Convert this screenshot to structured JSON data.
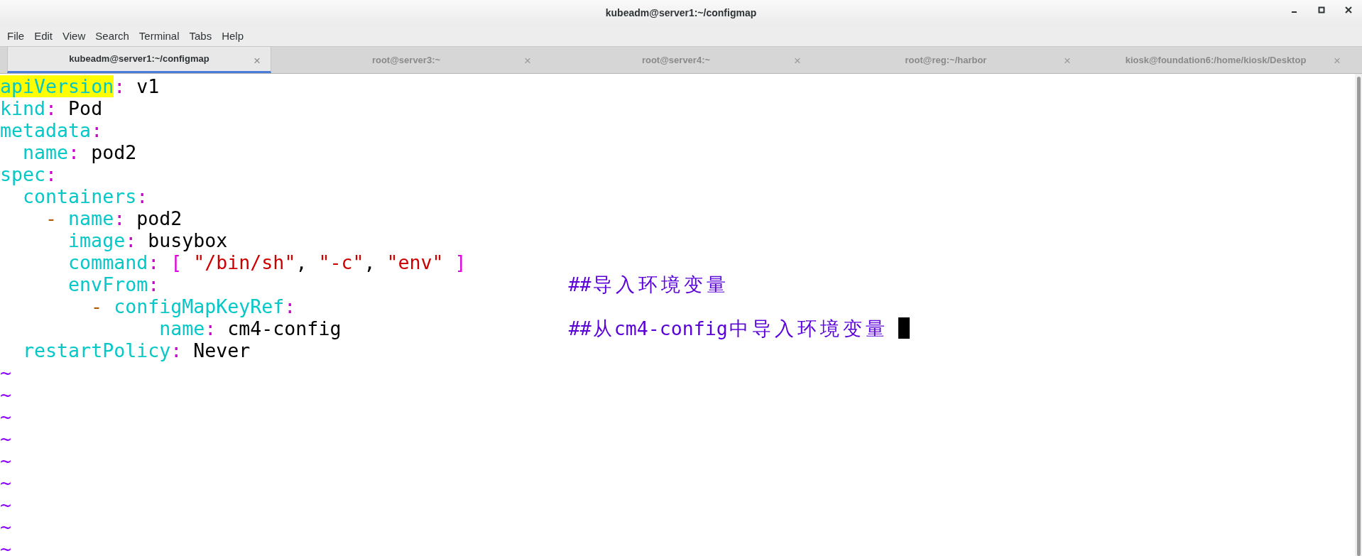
{
  "window": {
    "title": "kubeadm@server1:~/configmap"
  },
  "menu": [
    "File",
    "Edit",
    "View",
    "Search",
    "Terminal",
    "Tabs",
    "Help"
  ],
  "tabs": [
    {
      "label": "kubeadm@server1:~/configmap",
      "selected": true
    },
    {
      "label": "root@server3:~",
      "selected": false
    },
    {
      "label": "root@server4:~",
      "selected": false
    },
    {
      "label": "root@reg:~/harbor",
      "selected": false
    },
    {
      "label": "kiosk@foundation6:/home/kiosk/Desktop",
      "selected": false
    }
  ],
  "tab_close": "×",
  "editor": {
    "lines": [
      {
        "tokens": [
          {
            "kind": "key",
            "text": "apiVersion",
            "highlighted": true
          },
          {
            "kind": "colon",
            "text": ":"
          },
          {
            "kind": "value",
            "text": " v1"
          }
        ]
      },
      {
        "tokens": [
          {
            "kind": "key",
            "text": "kind"
          },
          {
            "kind": "colon",
            "text": ":"
          },
          {
            "kind": "value",
            "text": " Pod"
          }
        ]
      },
      {
        "tokens": [
          {
            "kind": "key",
            "text": "metadata"
          },
          {
            "kind": "colon",
            "text": ":"
          }
        ]
      },
      {
        "tokens": [
          {
            "kind": "key",
            "text": "  name"
          },
          {
            "kind": "colon",
            "text": ":"
          },
          {
            "kind": "value",
            "text": " pod2"
          }
        ]
      },
      {
        "tokens": [
          {
            "kind": "key",
            "text": "spec"
          },
          {
            "kind": "colon",
            "text": ":"
          }
        ]
      },
      {
        "tokens": [
          {
            "kind": "key",
            "text": "  containers"
          },
          {
            "kind": "colon",
            "text": ":"
          }
        ]
      },
      {
        "tokens": [
          {
            "kind": "dash",
            "text": "    -"
          },
          {
            "kind": "key",
            "text": " name"
          },
          {
            "kind": "colon",
            "text": ":"
          },
          {
            "kind": "value",
            "text": " pod2"
          }
        ]
      },
      {
        "tokens": [
          {
            "kind": "key",
            "text": "      image"
          },
          {
            "kind": "colon",
            "text": ":"
          },
          {
            "kind": "value",
            "text": " busybox"
          }
        ]
      },
      {
        "tokens": [
          {
            "kind": "key",
            "text": "      command"
          },
          {
            "kind": "colon",
            "text": ":"
          },
          {
            "kind": "bracket",
            "text": " ["
          },
          {
            "kind": "string",
            "text": " \"/bin/sh\""
          },
          {
            "kind": "comma",
            "text": ","
          },
          {
            "kind": "string",
            "text": " \"-c\""
          },
          {
            "kind": "comma",
            "text": ","
          },
          {
            "kind": "string",
            "text": " \"env\""
          },
          {
            "kind": "bracket",
            "text": " ]"
          }
        ]
      },
      {
        "tokens": [
          {
            "kind": "key",
            "text": "      envFrom"
          },
          {
            "kind": "colon",
            "text": ":"
          },
          {
            "kind": "comment",
            "text": "                                    ##导入环境变量"
          }
        ]
      },
      {
        "tokens": [
          {
            "kind": "dash",
            "text": "        -"
          },
          {
            "kind": "key",
            "text": " configMapKeyRef"
          },
          {
            "kind": "colon",
            "text": ":"
          }
        ]
      },
      {
        "tokens": [
          {
            "kind": "key",
            "text": "              name"
          },
          {
            "kind": "colon",
            "text": ":"
          },
          {
            "kind": "value",
            "text": " cm4-config"
          },
          {
            "kind": "comment",
            "text": "                    ##从cm4-config中导入环境变量 "
          }
        ],
        "cursor": true
      },
      {
        "tokens": [
          {
            "kind": "key",
            "text": "  restartPolicy"
          },
          {
            "kind": "colon",
            "text": ":"
          },
          {
            "kind": "value",
            "text": " Never"
          }
        ]
      }
    ],
    "empty_markers": [
      "~",
      "~",
      "~",
      "~",
      "~",
      "~",
      "~",
      "~",
      "~"
    ]
  }
}
